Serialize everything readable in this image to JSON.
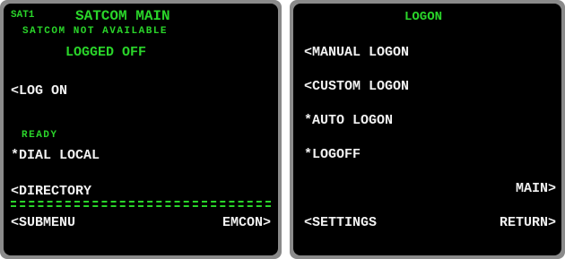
{
  "satcom": {
    "sat_id": "SAT1",
    "title": "SATCOM MAIN",
    "status": "SATCOM NOT AVAILABLE",
    "logon_state": "LOGGED OFF",
    "log_on": "<LOG ON",
    "ready_label": "READY",
    "dial_local": "*DIAL LOCAL",
    "directory": "<DIRECTORY",
    "submenu": "<SUBMENU",
    "emcon": "EMCON>"
  },
  "logon": {
    "title": "LOGON",
    "manual_logon": "<MANUAL LOGON",
    "custom_logon": "<CUSTOM LOGON",
    "auto_logon": "*AUTO LOGON",
    "logoff": "*LOGOFF",
    "main": "MAIN>",
    "settings": "<SETTINGS",
    "return": "RETURN>"
  },
  "colors": {
    "text_green": "#2ad52a",
    "text_white": "#f2f2f2",
    "screen_bg": "#000000",
    "bezel": "#8a8a8a"
  }
}
